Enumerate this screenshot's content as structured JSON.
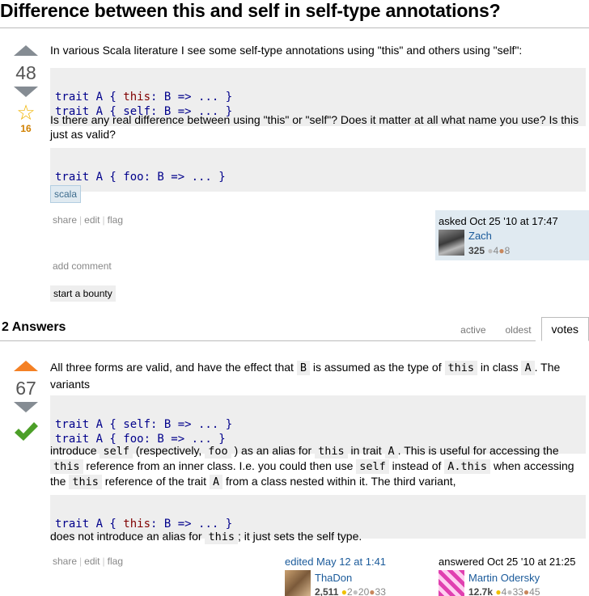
{
  "question": {
    "title": "Difference between this and self in self-type annotations?",
    "votes": "48",
    "favorites": "16",
    "intro": "In various Scala literature I see some self-type annotations using \"this\" and others using \"self\":",
    "code1_line1_a": "trait A {",
    "code1_line1_b": "this",
    "code1_line1_c": ": B => ... }",
    "code1_line2": "trait A { self: B => ... }",
    "question_text": "Is there any real difference between using \"this\" or \"self\"? Does it matter at all what name you use? Is this just as valid?",
    "code2": "trait A { foo: B => ... }",
    "tag": "scala",
    "menu": {
      "share": "share",
      "edit": "edit",
      "flag": "flag"
    },
    "asked": "asked Oct 25 '10 at 17:47",
    "user": {
      "name": "Zach",
      "rep": "325",
      "silver": "4",
      "bronze": "8"
    },
    "add_comment": "add comment",
    "bounty": "start a bounty"
  },
  "answers_header": {
    "title": "2 Answers",
    "tabs": [
      "active",
      "oldest",
      "votes"
    ]
  },
  "answer": {
    "votes": "67",
    "p1_a": "All three forms are valid, and have the effect that",
    "p1_code1": "B",
    "p1_b": "is assumed as the type of",
    "p1_code2": "this",
    "p1_c": "in class",
    "p1_code3": "A",
    "p1_d": ". The variants",
    "code1_line1": "trait A { self: B => ... }",
    "code1_line2": "trait A { foo: B => ... }",
    "p2_a": "introduce",
    "p2_c1": "self",
    "p2_b": "(respectively,",
    "p2_c2": "foo",
    "p2_c": ") as an alias for",
    "p2_c3": "this",
    "p2_d": "in trait",
    "p2_c4": "A",
    "p2_e": ". This is useful for accessing the",
    "p2_c5": "this",
    "p2_f": "reference from an inner class. I.e. you could then use",
    "p2_c6": "self",
    "p2_g": "instead of",
    "p2_c7": "A.this",
    "p2_h": "when accessing the",
    "p2_c8": "this",
    "p2_i": "reference of the trait",
    "p2_c9": "A",
    "p2_j": "from a class nested within it. The third variant,",
    "code2_a": "trait A {",
    "code2_b": "this",
    "code2_c": ": B => ... }",
    "p3_a": "does not introduce an alias for",
    "p3_code": "this",
    "p3_b": "; it just sets the self type.",
    "menu": {
      "share": "share",
      "edit": "edit",
      "flag": "flag"
    },
    "edited": "edited May 12 at 1:41",
    "editor": {
      "name": "ThaDon",
      "rep": "2,511",
      "gold": "2",
      "silver": "20",
      "bronze": "33"
    },
    "answered": "answered Oct 25 '10 at 21:25",
    "author": {
      "name": "Martin Odersky",
      "rep": "12.7k",
      "gold": "4",
      "silver": "33",
      "bronze": "45"
    }
  },
  "colors": {
    "accent_orange": "#f48024",
    "accepted_green": "#4c9f28",
    "link_blue": "#1a5a9a",
    "tag_bg": "#e0eaf1"
  }
}
